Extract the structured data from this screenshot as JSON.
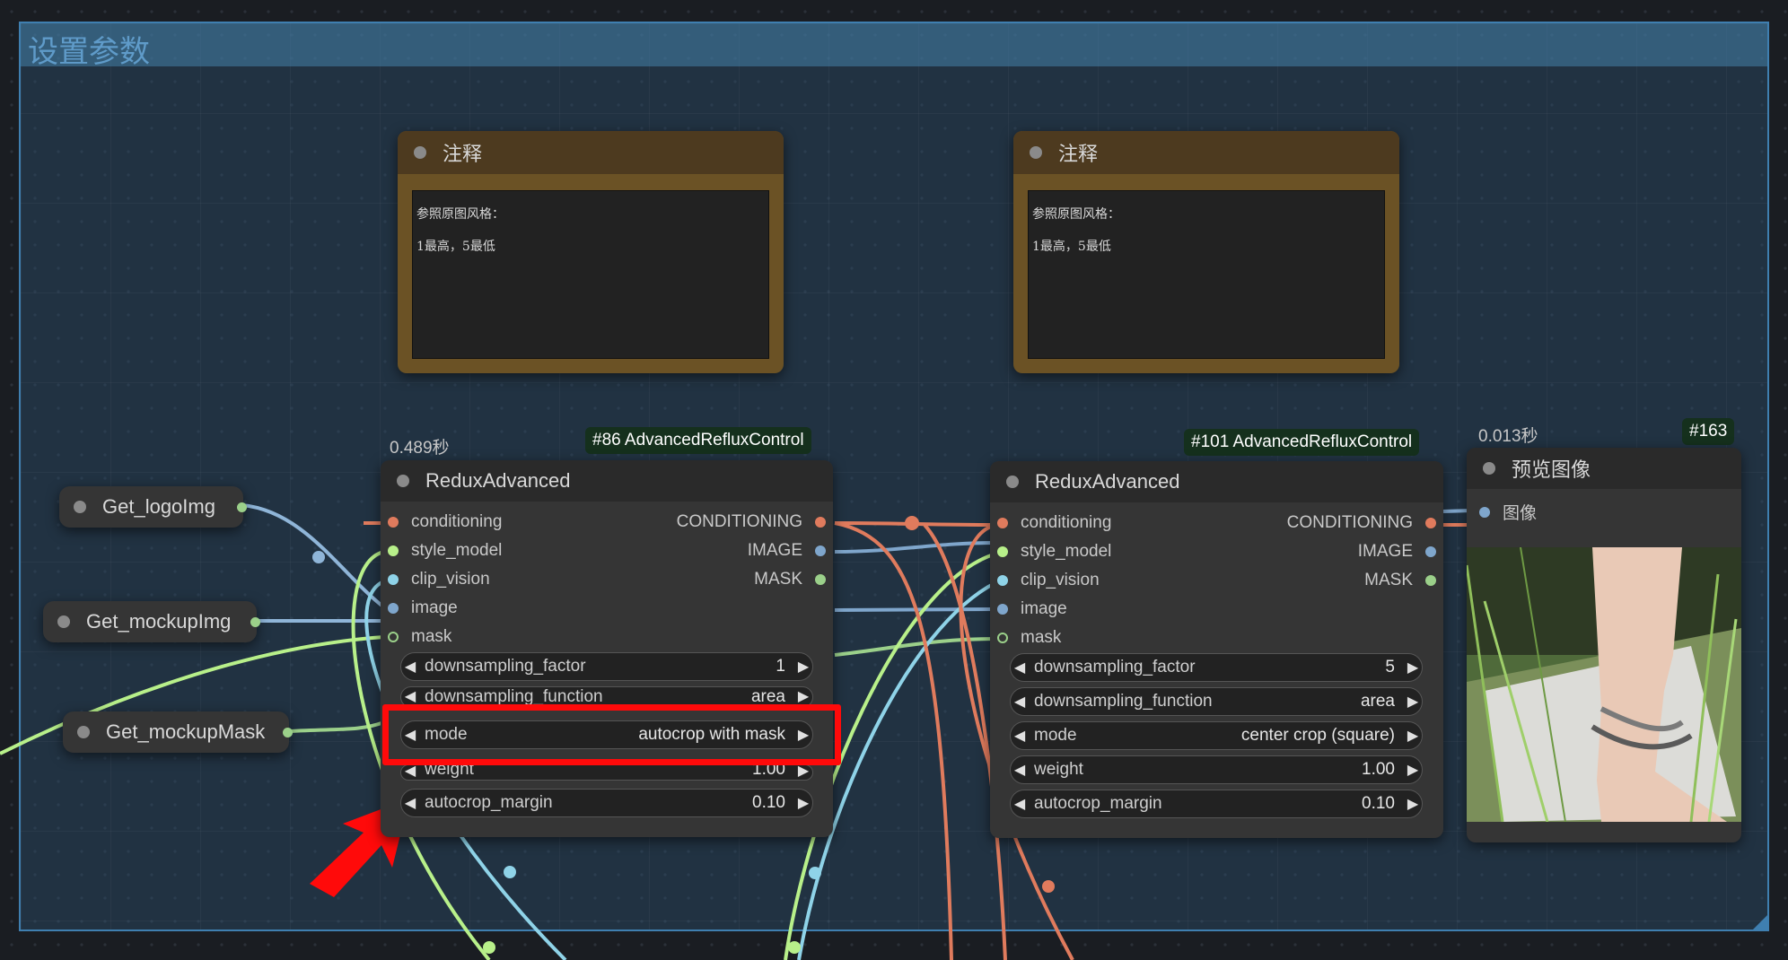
{
  "group": {
    "title": "设置参数"
  },
  "notes": [
    {
      "title": "注释",
      "line1": "参照原图风格：",
      "line2": "1最高，5最低"
    },
    {
      "title": "注释",
      "line1": "参照原图风格：",
      "line2": "1最高，5最低"
    }
  ],
  "get_nodes": [
    {
      "label": "Get_logoImg"
    },
    {
      "label": "Get_mockupImg"
    },
    {
      "label": "Get_mockupMask"
    }
  ],
  "redux_nodes": [
    {
      "time": "0.489秒",
      "badge": "#86 AdvancedRefluxControl",
      "title": "ReduxAdvanced",
      "inputs": [
        "conditioning",
        "style_model",
        "clip_vision",
        "image",
        "mask"
      ],
      "outputs": [
        "CONDITIONING",
        "IMAGE",
        "MASK"
      ],
      "widgets": [
        {
          "label": "downsampling_factor",
          "value": "1"
        },
        {
          "label": "downsampling_function",
          "value": "area"
        },
        {
          "label": "mode",
          "value": "autocrop with mask"
        },
        {
          "label": "weight",
          "value": "1.00"
        },
        {
          "label": "autocrop_margin",
          "value": "0.10"
        }
      ]
    },
    {
      "time": "",
      "badge": "#101 AdvancedRefluxControl",
      "title": "ReduxAdvanced",
      "inputs": [
        "conditioning",
        "style_model",
        "clip_vision",
        "image",
        "mask"
      ],
      "outputs": [
        "CONDITIONING",
        "IMAGE",
        "MASK"
      ],
      "widgets": [
        {
          "label": "downsampling_factor",
          "value": "5"
        },
        {
          "label": "downsampling_function",
          "value": "area"
        },
        {
          "label": "mode",
          "value": "center crop (square)"
        },
        {
          "label": "weight",
          "value": "1.00"
        },
        {
          "label": "autocrop_margin",
          "value": "0.10"
        }
      ]
    }
  ],
  "preview_node": {
    "time": "0.013秒",
    "badge": "#163",
    "title": "预览图像",
    "input": "图像"
  },
  "colors": {
    "conditioning": "#e07b5d",
    "style_model": "#b8f08a",
    "clip_vision": "#8fd3e8",
    "image": "#7fa6cc",
    "mask": "#8aa870",
    "highlight": "#ff0a0a"
  }
}
